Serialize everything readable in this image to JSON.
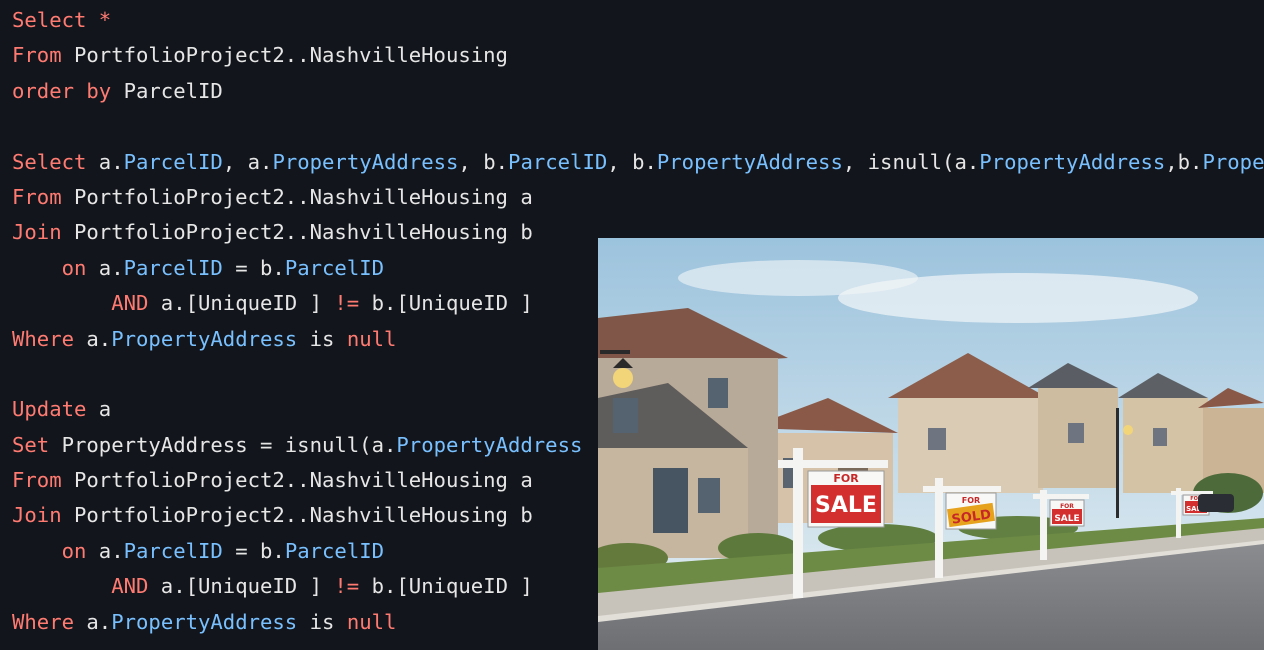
{
  "editor": {
    "colors": {
      "background": "#12151b",
      "keyword": "#ff7b72",
      "object": "#79c0ff",
      "text": "#e6e6e6"
    },
    "lines": [
      [
        {
          "t": "Select ",
          "c": "kw"
        },
        {
          "t": "*",
          "c": "kw"
        }
      ],
      [
        {
          "t": "From ",
          "c": "kw"
        },
        {
          "t": "PortfolioProject2..NashvilleHousing",
          "c": "tx"
        }
      ],
      [
        {
          "t": "order by ",
          "c": "kw"
        },
        {
          "t": "ParcelID",
          "c": "tx"
        }
      ],
      [],
      [
        {
          "t": "Select ",
          "c": "kw"
        },
        {
          "t": "a.",
          "c": "tx"
        },
        {
          "t": "ParcelID",
          "c": "ob"
        },
        {
          "t": ", ",
          "c": "tx"
        },
        {
          "t": "a.",
          "c": "tx"
        },
        {
          "t": "PropertyAddress",
          "c": "ob"
        },
        {
          "t": ", ",
          "c": "tx"
        },
        {
          "t": "b.",
          "c": "tx"
        },
        {
          "t": "ParcelID",
          "c": "ob"
        },
        {
          "t": ", ",
          "c": "tx"
        },
        {
          "t": "b.",
          "c": "tx"
        },
        {
          "t": "PropertyAddress",
          "c": "ob"
        },
        {
          "t": ", isnull(",
          "c": "tx"
        },
        {
          "t": "a.",
          "c": "tx"
        },
        {
          "t": "PropertyAddress",
          "c": "ob"
        },
        {
          "t": ",",
          "c": "tx"
        },
        {
          "t": "b.",
          "c": "tx"
        },
        {
          "t": "PropertyAddress",
          "c": "ob"
        },
        {
          "t": ")",
          "c": "tx"
        }
      ],
      [
        {
          "t": "From ",
          "c": "kw"
        },
        {
          "t": "PortfolioProject2..NashvilleHousing a",
          "c": "tx"
        }
      ],
      [
        {
          "t": "Join ",
          "c": "kw"
        },
        {
          "t": "PortfolioProject2..NashvilleHousing b",
          "c": "tx"
        }
      ],
      [
        {
          "t": "    on ",
          "c": "kw"
        },
        {
          "t": "a.",
          "c": "tx"
        },
        {
          "t": "ParcelID",
          "c": "ob"
        },
        {
          "t": " = ",
          "c": "tx"
        },
        {
          "t": "b.",
          "c": "tx"
        },
        {
          "t": "ParcelID",
          "c": "ob"
        }
      ],
      [
        {
          "t": "        AND ",
          "c": "kw"
        },
        {
          "t": "a.[UniqueID ] ",
          "c": "tx"
        },
        {
          "t": "!=",
          "c": "kw"
        },
        {
          "t": " b.[UniqueID ]",
          "c": "tx"
        }
      ],
      [
        {
          "t": "Where ",
          "c": "kw"
        },
        {
          "t": "a.",
          "c": "tx"
        },
        {
          "t": "PropertyAddress",
          "c": "ob"
        },
        {
          "t": " is ",
          "c": "tx"
        },
        {
          "t": "null",
          "c": "kw"
        }
      ],
      [],
      [
        {
          "t": "Update ",
          "c": "kw"
        },
        {
          "t": "a",
          "c": "tx"
        }
      ],
      [
        {
          "t": "Set ",
          "c": "kw"
        },
        {
          "t": "PropertyAddress = isnull(",
          "c": "tx"
        },
        {
          "t": "a.",
          "c": "tx"
        },
        {
          "t": "PropertyAddress",
          "c": "ob"
        }
      ],
      [
        {
          "t": "From ",
          "c": "kw"
        },
        {
          "t": "PortfolioProject2..NashvilleHousing a",
          "c": "tx"
        }
      ],
      [
        {
          "t": "Join ",
          "c": "kw"
        },
        {
          "t": "PortfolioProject2..NashvilleHousing b",
          "c": "tx"
        }
      ],
      [
        {
          "t": "    on ",
          "c": "kw"
        },
        {
          "t": "a.",
          "c": "tx"
        },
        {
          "t": "ParcelID",
          "c": "ob"
        },
        {
          "t": " = ",
          "c": "tx"
        },
        {
          "t": "b.",
          "c": "tx"
        },
        {
          "t": "ParcelID",
          "c": "ob"
        }
      ],
      [
        {
          "t": "        AND ",
          "c": "kw"
        },
        {
          "t": "a.[UniqueID ] ",
          "c": "tx"
        },
        {
          "t": "!=",
          "c": "kw"
        },
        {
          "t": " b.[UniqueID ]",
          "c": "tx"
        }
      ],
      [
        {
          "t": "Where ",
          "c": "kw"
        },
        {
          "t": "a.",
          "c": "tx"
        },
        {
          "t": "PropertyAddress",
          "c": "ob"
        },
        {
          "t": " is ",
          "c": "tx"
        },
        {
          "t": "null",
          "c": "kw"
        }
      ]
    ]
  },
  "photo": {
    "signs": [
      {
        "top": "FOR",
        "main": "SALE"
      },
      {
        "top": "FOR",
        "main": "SOLD"
      },
      {
        "top": "FOR",
        "main": "SALE"
      },
      {
        "top": "FOR",
        "main": "SALE"
      }
    ]
  }
}
